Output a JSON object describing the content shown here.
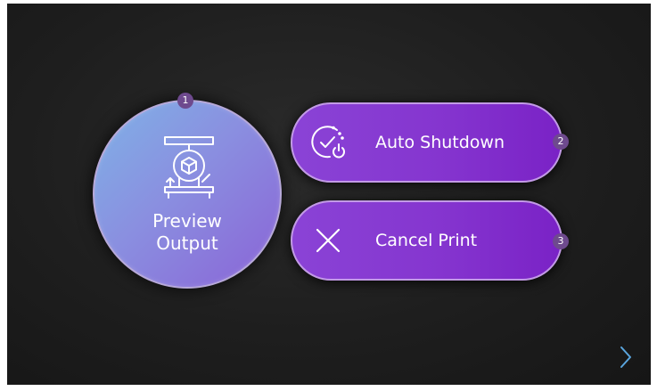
{
  "buttons": {
    "preview": {
      "line1": "Preview",
      "line2": "Output",
      "badge": "1",
      "icon": "printer-preview-icon"
    },
    "shutdown": {
      "label": "Auto Shutdown",
      "badge": "2",
      "icon": "timer-power-icon"
    },
    "cancel": {
      "label": "Cancel Print",
      "badge": "3",
      "icon": "close-icon"
    }
  },
  "navigation": {
    "next_icon": "chevron-right-icon"
  },
  "colors": {
    "background": "#1e1e1e",
    "circle_start": "#7fb2e6",
    "circle_end": "#8a63d6",
    "pill": "#8535cf",
    "badge": "#6e4a8e",
    "arrow": "#5aa6df"
  }
}
